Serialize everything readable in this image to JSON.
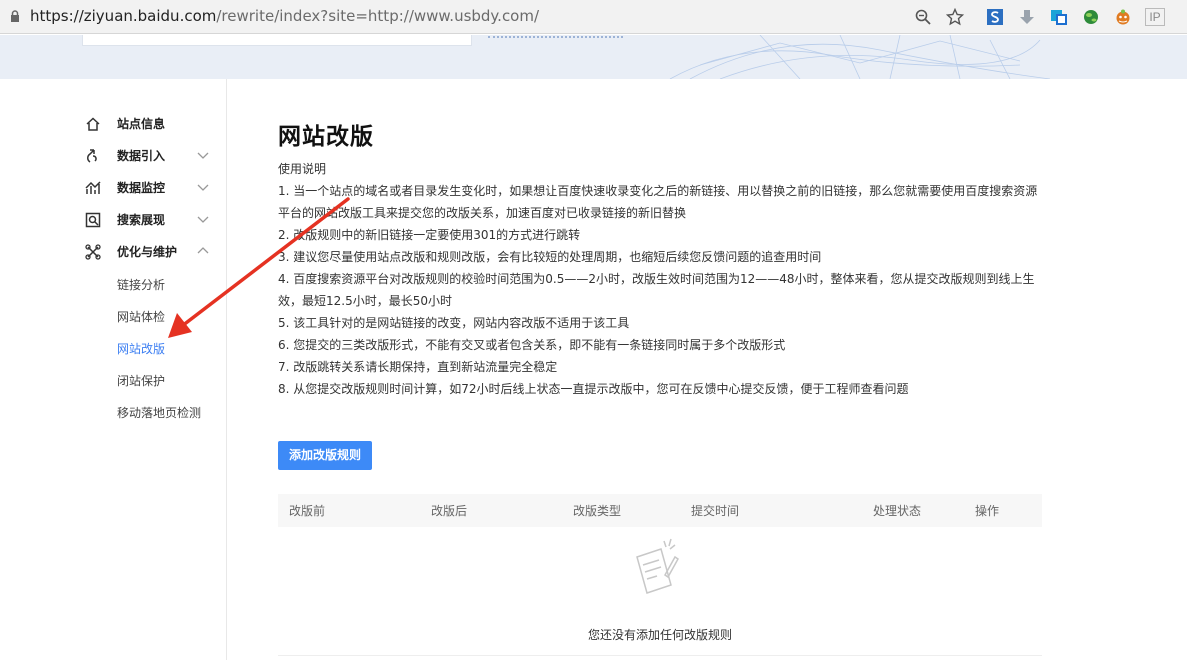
{
  "browser": {
    "url_host": "https://ziyuan.baidu.com",
    "url_path": "/rewrite/index?site=http://www.usbdy.com/",
    "ext_ip_label": "IP"
  },
  "sidebar": {
    "items": [
      {
        "label": "站点信息",
        "icon": "home-icon"
      },
      {
        "label": "数据引入",
        "icon": "data-import-icon"
      },
      {
        "label": "数据监控",
        "icon": "chart-icon"
      },
      {
        "label": "搜索展现",
        "icon": "search-display-icon"
      },
      {
        "label": "优化与维护",
        "icon": "optimize-icon"
      }
    ],
    "sub_items": [
      "链接分析",
      "网站体检",
      "网站改版",
      "闭站保护",
      "移动落地页检测"
    ],
    "active_sub": "网站改版"
  },
  "main": {
    "title": "网站改版",
    "desc_heading": "使用说明",
    "desc_lines": [
      "1. 当一个站点的域名或者目录发生变化时，如果想让百度快速收录变化之后的新链接、用以替换之前的旧链接，那么您就需要使用百度搜索资源",
      "平台的网站改版工具来提交您的改版关系，加速百度对已收录链接的新旧替换",
      "2. 改版规则中的新旧链接一定要使用301的方式进行跳转",
      "3. 建议您尽量使用站点改版和规则改版，会有比较短的处理周期，也缩短后续您反馈问题的追查用时间",
      "4. 百度搜索资源平台对改版规则的校验时间范围为0.5——2小时，改版生效时间范围为12——48小时，整体来看，您从提交改版规则到线上生",
      "效，最短12.5小时，最长50小时",
      "5. 该工具针对的是网站链接的改变，网站内容改版不适用于该工具",
      "6. 您提交的三类改版形式，不能有交叉或者包含关系，即不能有一条链接同时属于多个改版形式",
      "7. 改版跳转关系请长期保持，直到新站流量完全稳定",
      "8. 从您提交改版规则时间计算，如72小时后线上状态一直提示改版中，您可在反馈中心提交反馈，便于工程师查看问题"
    ],
    "add_button": "添加改版规则",
    "table_headers": [
      "改版前",
      "改版后",
      "改版类型",
      "提交时间",
      "处理状态",
      "操作"
    ],
    "empty_text": "您还没有添加任何改版规则"
  },
  "colors": {
    "accent": "#3d8af7",
    "active_link": "#3d7ff2",
    "annotation_arrow": "#e53222"
  }
}
